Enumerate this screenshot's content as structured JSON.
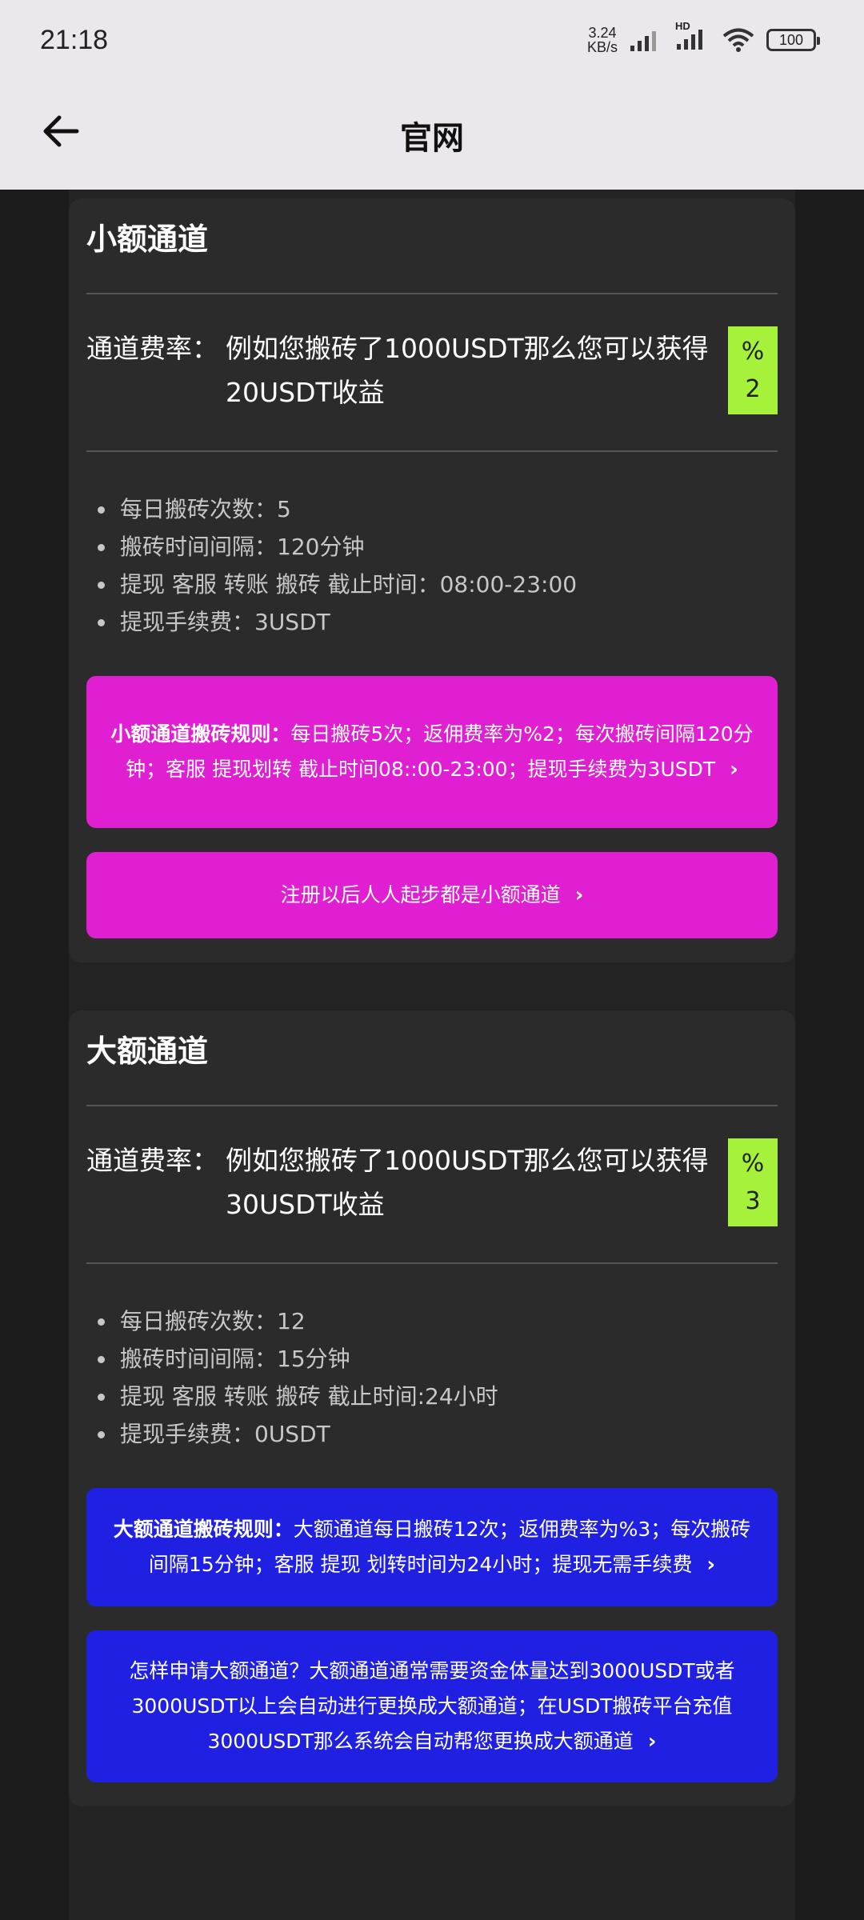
{
  "status_bar": {
    "time": "21:18",
    "net_speed_value": "3.24",
    "net_speed_unit": "KB/s",
    "hd_label": "HD",
    "battery": "100",
    "icons": [
      "signal-icon",
      "signal-hd-icon",
      "wifi-icon",
      "battery-icon"
    ]
  },
  "header": {
    "title": "官网",
    "back_icon": "arrow-left-icon"
  },
  "small_channel": {
    "title": "小额通道",
    "rate_label": "通道费率：",
    "rate_desc": "例如您搬砖了1000USDT那么您可以获得20USDT收益",
    "badge_symbol": "%",
    "badge_value": "2",
    "bullets": [
      "每日搬砖次数：5",
      "搬砖时间间隔：120分钟",
      "提现 客服 转账 搬砖 截止时间：08:00-23:00",
      "提现手续费：3USDT"
    ],
    "rule_bold": "小额通道搬砖规则：",
    "rule_text": "每日搬砖5次；返佣费率为%2；每次搬砖间隔120分钟；客服 提现划转 截止时间08::00-23:00；提现手续费为3USDT",
    "note": "注册以后人人起步都是小额通道",
    "accent": "#e11fd2"
  },
  "large_channel": {
    "title": "大额通道",
    "rate_label": "通道费率：",
    "rate_desc": "例如您搬砖了1000USDT那么您可以获得30USDT收益",
    "badge_symbol": "%",
    "badge_value": "3",
    "bullets": [
      "每日搬砖次数：12",
      "搬砖时间间隔：15分钟",
      "提现 客服 转账 搬砖 截止时间:24小时",
      "提现手续费：0USDT"
    ],
    "rule_bold": "大额通道搬砖规则：",
    "rule_text": "大额通道每日搬砖12次；返佣费率为%3；每次搬砖间隔15分钟；客服 提现 划转时间为24小时；提现无需手续费",
    "note": "怎样申请大额通道？大额通道通常需要资金体量达到3000USDT或者3000USDT以上会自动进行更换成大额通道；在USDT搬砖平台充值3000USDT那么系统会自动帮您更换成大额通道",
    "accent": "#2020e3"
  },
  "badge_color": "#a6f13a"
}
